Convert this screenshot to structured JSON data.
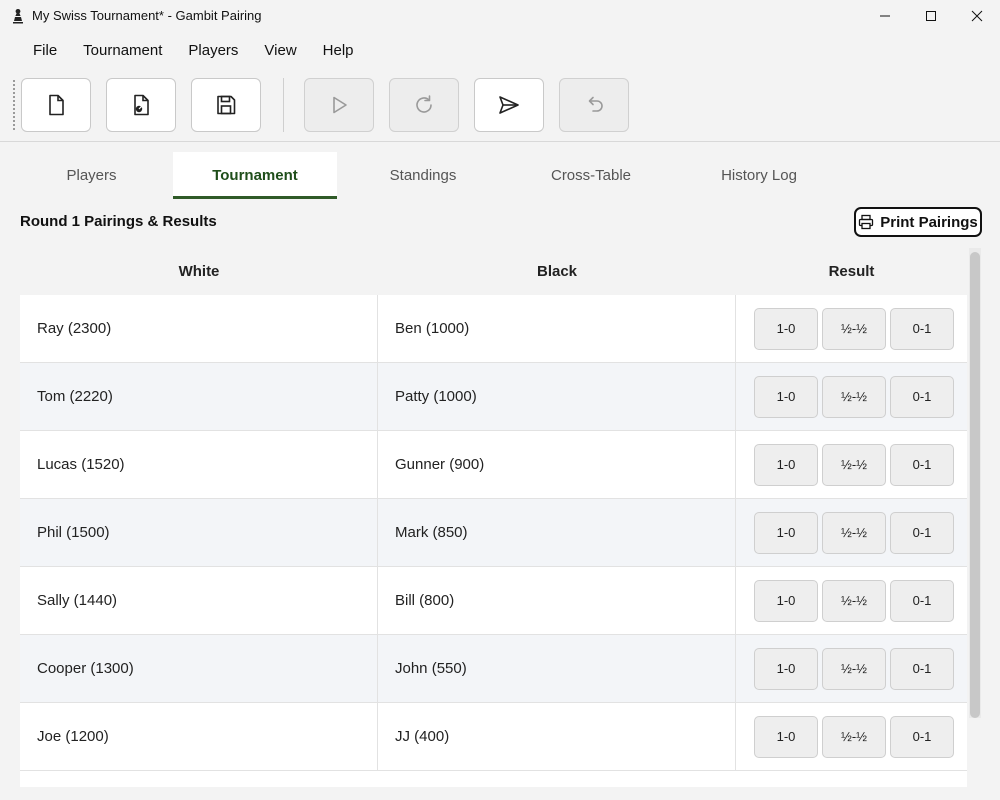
{
  "window": {
    "title": "My Swiss Tournament* - Gambit Pairing",
    "app_icon": "chess-pawn-icon"
  },
  "menu": [
    "File",
    "Tournament",
    "Players",
    "View",
    "Help"
  ],
  "toolbar": {
    "buttons": [
      {
        "icon": "new-document-icon",
        "enabled": true
      },
      {
        "icon": "open-document-icon",
        "enabled": true
      },
      {
        "icon": "save-icon",
        "enabled": true
      },
      {
        "icon": "play-icon",
        "enabled": false
      },
      {
        "icon": "refresh-icon",
        "enabled": false
      },
      {
        "icon": "send-icon",
        "enabled": true
      },
      {
        "icon": "undo-icon",
        "enabled": false
      }
    ]
  },
  "tabs": [
    {
      "label": "Players",
      "active": false
    },
    {
      "label": "Tournament",
      "active": true
    },
    {
      "label": "Standings",
      "active": false
    },
    {
      "label": "Cross-Table",
      "active": false
    },
    {
      "label": "History Log",
      "active": false
    }
  ],
  "section": {
    "title": "Round 1 Pairings & Results",
    "print_label": "Print Pairings"
  },
  "table": {
    "headers": {
      "white": "White",
      "black": "Black",
      "result": "Result"
    },
    "result_options": [
      "1-0",
      "½-½",
      "0-1"
    ],
    "rows": [
      {
        "white": "Ray (2300)",
        "black": "Ben (1000)"
      },
      {
        "white": "Tom (2220)",
        "black": "Patty (1000)"
      },
      {
        "white": "Lucas (1520)",
        "black": "Gunner (900)"
      },
      {
        "white": "Phil (1500)",
        "black": "Mark (850)"
      },
      {
        "white": "Sally (1440)",
        "black": "Bill (800)"
      },
      {
        "white": "Cooper (1300)",
        "black": "John (550)"
      },
      {
        "white": "Joe (1200)",
        "black": "JJ (400)"
      }
    ]
  },
  "colors": {
    "accent": "#2f5a27",
    "active_tab_text": "#1f4e1a"
  }
}
